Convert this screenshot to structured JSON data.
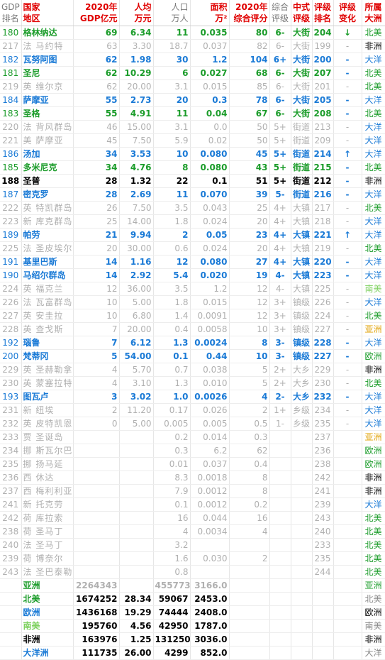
{
  "headers": {
    "gdp_rank": [
      "GDP",
      "排名"
    ],
    "country": [
      "国家",
      "地区"
    ],
    "gdp": [
      "2020年",
      "GDP亿元"
    ],
    "per_capita": [
      "人均",
      "万元"
    ],
    "population": [
      "人口",
      "万人"
    ],
    "area": [
      "面积",
      "万²"
    ],
    "score": [
      "2020年",
      "综合评分"
    ],
    "grade": [
      "综合",
      "评级"
    ],
    "cn_grade": [
      "中式",
      "评级"
    ],
    "grade_rank": [
      "评级",
      "排名"
    ],
    "change": [
      "评级",
      "变化"
    ],
    "continent": [
      "所属",
      "大洲"
    ]
  },
  "rows": [
    {
      "style": "green",
      "rank": "180",
      "name": "格林纳达",
      "gdp": "69",
      "pc": "6.34",
      "pop": "11",
      "area": "0.035",
      "score": "80",
      "grade": "6-",
      "tier": "大街",
      "grank": "204",
      "chg": "↓",
      "cont": "北美",
      "cc": "#1b9c2a"
    },
    {
      "style": "gray",
      "rank": "217",
      "name": "法 马约特",
      "gdp": "63",
      "pc": "3.30",
      "pop": "18.7",
      "area": "0.037",
      "score": "82",
      "grade": "6-",
      "tier": "大街",
      "grank": "199",
      "chg": "-",
      "cont": "非洲",
      "cc": "#000000"
    },
    {
      "style": "blue",
      "rank": "182",
      "name": "瓦努阿图",
      "gdp": "62",
      "pc": "1.98",
      "pop": "30",
      "area": "1.2",
      "score": "104",
      "grade": "6+",
      "tier": "大街",
      "grank": "200",
      "chg": "-",
      "cont": "大洋",
      "cc": "#1a7ad6"
    },
    {
      "style": "green",
      "rank": "181",
      "name": "圣尼",
      "gdp": "62",
      "pc": "10.29",
      "pop": "6",
      "area": "0.027",
      "score": "68",
      "grade": "6-",
      "tier": "大街",
      "grank": "207",
      "chg": "-",
      "cont": "北美",
      "cc": "#1b9c2a"
    },
    {
      "style": "gray",
      "rank": "219",
      "name": "英 维尔京",
      "gdp": "62",
      "pc": "20.00",
      "pop": "3.1",
      "area": "0.015",
      "score": "85",
      "grade": "6-",
      "tier": "大街",
      "grank": "201",
      "chg": "-",
      "cont": "北美",
      "cc": "#1b9c2a"
    },
    {
      "style": "blue",
      "rank": "184",
      "name": "萨摩亚",
      "gdp": "55",
      "pc": "2.73",
      "pop": "20",
      "area": "0.3",
      "score": "78",
      "grade": "6-",
      "tier": "大街",
      "grank": "205",
      "chg": "-",
      "cont": "大洋",
      "cc": "#1a7ad6"
    },
    {
      "style": "green",
      "rank": "183",
      "name": "圣格",
      "gdp": "55",
      "pc": "4.91",
      "pop": "11",
      "area": "0.04",
      "score": "67",
      "grade": "6-",
      "tier": "大街",
      "grank": "208",
      "chg": "-",
      "cont": "北美",
      "cc": "#1b9c2a"
    },
    {
      "style": "gray",
      "rank": "220",
      "name": "法 背风群岛",
      "gdp": "46",
      "pc": "15.00",
      "pop": "3.1",
      "area": "0.0",
      "score": "50",
      "grade": "5+",
      "tier": "街道",
      "grank": "213",
      "chg": "-",
      "cont": "大洋",
      "cc": "#1a7ad6"
    },
    {
      "style": "gray",
      "rank": "221",
      "name": "美 萨摩亚",
      "gdp": "45",
      "pc": "7.50",
      "pop": "5.9",
      "area": "0.02",
      "score": "50",
      "grade": "5+",
      "tier": "街道",
      "grank": "209",
      "chg": "-",
      "cont": "大洋",
      "cc": "#1a7ad6"
    },
    {
      "style": "blue",
      "rank": "186",
      "name": "汤加",
      "gdp": "34",
      "pc": "3.53",
      "pop": "10",
      "area": "0.080",
      "score": "45",
      "grade": "5+",
      "tier": "街道",
      "grank": "214",
      "chg": "↑",
      "cont": "大洋",
      "cc": "#1a7ad6"
    },
    {
      "style": "green",
      "rank": "185",
      "name": "多米尼克",
      "gdp": "34",
      "pc": "4.76",
      "pop": "8",
      "area": "0.080",
      "score": "43",
      "grade": "5+",
      "tier": "街道",
      "grank": "215",
      "chg": "-",
      "cont": "北美",
      "cc": "#1b9c2a"
    },
    {
      "style": "black",
      "rank": "188",
      "name": "圣普",
      "gdp": "28",
      "pc": "1.32",
      "pop": "22",
      "area": "0.1",
      "score": "51",
      "grade": "5+",
      "tier": "街道",
      "grank": "212",
      "chg": "-",
      "cont": "非洲",
      "cc": "#000000"
    },
    {
      "style": "blue",
      "rank": "187",
      "name": "密克罗",
      "gdp": "28",
      "pc": "2.69",
      "pop": "11",
      "area": "0.070",
      "score": "39",
      "grade": "5-",
      "tier": "街道",
      "grank": "216",
      "chg": "-",
      "cont": "大洋",
      "cc": "#1a7ad6"
    },
    {
      "style": "gray",
      "rank": "222",
      "name": "英 特凯群岛",
      "gdp": "26",
      "pc": "7.50",
      "pop": "3.5",
      "area": "0.043",
      "score": "25",
      "grade": "4+",
      "tier": "大镇",
      "grank": "217",
      "chg": "-",
      "cont": "北美",
      "cc": "#1b9c2a"
    },
    {
      "style": "gray",
      "rank": "223",
      "name": "新 库克群岛",
      "gdp": "25",
      "pc": "14.00",
      "pop": "1.8",
      "area": "0.024",
      "score": "20",
      "grade": "4+",
      "tier": "大镇",
      "grank": "218",
      "chg": "-",
      "cont": "大洋",
      "cc": "#1a7ad6"
    },
    {
      "style": "blue",
      "rank": "189",
      "name": "帕劳",
      "gdp": "21",
      "pc": "9.94",
      "pop": "2",
      "area": "0.05",
      "score": "23",
      "grade": "4+",
      "tier": "大镇",
      "grank": "221",
      "chg": "↑",
      "cont": "大洋",
      "cc": "#1a7ad6"
    },
    {
      "style": "gray",
      "rank": "225",
      "name": "法 圣皮埃尔",
      "gdp": "20",
      "pc": "30.00",
      "pop": "0.6",
      "area": "0.024",
      "score": "20",
      "grade": "4+",
      "tier": "大镇",
      "grank": "219",
      "chg": "-",
      "cont": "北美",
      "cc": "#1b9c2a"
    },
    {
      "style": "blue",
      "rank": "191",
      "name": "基里巴斯",
      "gdp": "14",
      "pc": "1.16",
      "pop": "12",
      "area": "0.080",
      "score": "27",
      "grade": "4+",
      "tier": "大镇",
      "grank": "220",
      "chg": "-",
      "cont": "大洋",
      "cc": "#1a7ad6"
    },
    {
      "style": "blue",
      "rank": "190",
      "name": "马绍尔群岛",
      "gdp": "14",
      "pc": "2.92",
      "pop": "5.4",
      "area": "0.020",
      "score": "19",
      "grade": "4-",
      "tier": "大镇",
      "grank": "223",
      "chg": "-",
      "cont": "大洋",
      "cc": "#1a7ad6"
    },
    {
      "style": "gray",
      "rank": "224",
      "name": "英 福克兰",
      "gdp": "12",
      "pc": "36.00",
      "pop": "3.5",
      "area": "1.2",
      "score": "12",
      "grade": "4-",
      "tier": "大镇",
      "grank": "225",
      "chg": "-",
      "cont": "南美",
      "cc": "#7fd160"
    },
    {
      "style": "gray",
      "rank": "226",
      "name": "法 瓦富群岛",
      "gdp": "10",
      "pc": "5.00",
      "pop": "1.8",
      "area": "0.015",
      "score": "12",
      "grade": "3+",
      "tier": "镇级",
      "grank": "226",
      "chg": "-",
      "cont": "大洋",
      "cc": "#1a7ad6"
    },
    {
      "style": "gray",
      "rank": "227",
      "name": "英 安圭拉",
      "gdp": "10",
      "pc": "6.80",
      "pop": "1.4",
      "area": "0.0091",
      "score": "12",
      "grade": "3+",
      "tier": "镇级",
      "grank": "224",
      "chg": "-",
      "cont": "北美",
      "cc": "#1b9c2a"
    },
    {
      "style": "gray",
      "rank": "228",
      "name": "英 查戈斯",
      "gdp": "7",
      "pc": "20.00",
      "pop": "0.4",
      "area": "0.0058",
      "score": "10",
      "grade": "3+",
      "tier": "镇级",
      "grank": "227",
      "chg": "-",
      "cont": "亚洲",
      "cc": "#e0a000"
    },
    {
      "style": "blue",
      "rank": "192",
      "name": "瑙鲁",
      "gdp": "7",
      "pc": "6.12",
      "pop": "1.3",
      "area": "0.0024",
      "score": "8",
      "grade": "3-",
      "tier": "镇级",
      "grank": "228",
      "chg": "-",
      "cont": "大洋",
      "cc": "#1a7ad6"
    },
    {
      "style": "blue",
      "rank": "200",
      "name": "梵蒂冈",
      "gdp": "5",
      "pc": "54.00",
      "pop": "0.1",
      "area": "0.44",
      "score": "10",
      "grade": "3-",
      "tier": "镇级",
      "grank": "227",
      "chg": "-",
      "cont": "欧洲",
      "cc": "#1b9c2a"
    },
    {
      "style": "gray",
      "rank": "229",
      "name": "英 圣赫勒拿",
      "gdp": "4",
      "pc": "5.70",
      "pop": "0.7",
      "area": "0.038",
      "score": "5",
      "grade": "2+",
      "tier": "大乡",
      "grank": "229",
      "chg": "-",
      "cont": "非洲",
      "cc": "#000000"
    },
    {
      "style": "gray",
      "rank": "230",
      "name": "英 蒙塞拉特",
      "gdp": "4",
      "pc": "3.10",
      "pop": "1.3",
      "area": "0.010",
      "score": "5",
      "grade": "2+",
      "tier": "大乡",
      "grank": "230",
      "chg": "-",
      "cont": "北美",
      "cc": "#1b9c2a"
    },
    {
      "style": "blue",
      "rank": "193",
      "name": "图瓦卢",
      "gdp": "3",
      "pc": "3.02",
      "pop": "1.0",
      "area": "0.0026",
      "score": "4",
      "grade": "2-",
      "tier": "大乡",
      "grank": "232",
      "chg": "-",
      "cont": "大洋",
      "cc": "#1a7ad6"
    },
    {
      "style": "gray",
      "rank": "231",
      "name": "新 纽埃",
      "gdp": "2",
      "pc": "11.20",
      "pop": "0.17",
      "area": "0.026",
      "score": "2",
      "grade": "1+",
      "tier": "乡级",
      "grank": "234",
      "chg": "-",
      "cont": "大洋",
      "cc": "#1a7ad6"
    },
    {
      "style": "gray",
      "rank": "232",
      "name": "英 皮特凯恩",
      "gdp": "0",
      "pc": "5.00",
      "pop": "0.005",
      "area": "0.005",
      "score": "0.5",
      "grade": "1-",
      "tier": "乡级",
      "grank": "235",
      "chg": "-",
      "cont": "大洋",
      "cc": "#1a7ad6"
    },
    {
      "style": "gray",
      "rank": "233",
      "name": "贾 圣诞岛",
      "gdp": "",
      "pc": "",
      "pop": "0.2",
      "area": "0.014",
      "score": "0.3",
      "grade": "",
      "tier": "",
      "grank": "237",
      "chg": "",
      "cont": "亚洲",
      "cc": "#e0a000"
    },
    {
      "style": "gray",
      "rank": "234",
      "name": "挪 斯瓦尔巴",
      "gdp": "",
      "pc": "",
      "pop": "0.3",
      "area": "6.2",
      "score": "62",
      "grade": "",
      "tier": "",
      "grank": "236",
      "chg": "",
      "cont": "欧洲",
      "cc": "#1b9c2a"
    },
    {
      "style": "gray",
      "rank": "235",
      "name": "挪 扬马延",
      "gdp": "",
      "pc": "",
      "pop": "0.01",
      "area": "0.037",
      "score": "0.4",
      "grade": "",
      "tier": "",
      "grank": "238",
      "chg": "",
      "cont": "欧洲",
      "cc": "#1b9c2a"
    },
    {
      "style": "gray",
      "rank": "236",
      "name": "西 休达",
      "gdp": "",
      "pc": "",
      "pop": "8.3",
      "area": "0.0018",
      "score": "8",
      "grade": "",
      "tier": "",
      "grank": "242",
      "chg": "",
      "cont": "非洲",
      "cc": "#000000"
    },
    {
      "style": "gray",
      "rank": "237",
      "name": "西 梅利利亚",
      "gdp": "",
      "pc": "",
      "pop": "7.9",
      "area": "0.0012",
      "score": "8",
      "grade": "",
      "tier": "",
      "grank": "241",
      "chg": "",
      "cont": "非洲",
      "cc": "#000000"
    },
    {
      "style": "gray",
      "rank": "241",
      "name": "新 托克劳",
      "gdp": "",
      "pc": "",
      "pop": "0.1",
      "area": "0.0012",
      "score": "0.2",
      "grade": "",
      "tier": "",
      "grank": "239",
      "chg": "",
      "cont": "大洋",
      "cc": "#1a7ad6"
    },
    {
      "style": "gray",
      "rank": "242",
      "name": "荷 库拉索",
      "gdp": "",
      "pc": "",
      "pop": "16",
      "area": "0.044",
      "score": "16",
      "grade": "",
      "tier": "",
      "grank": "243",
      "chg": "",
      "cont": "北美",
      "cc": "#1b9c2a"
    },
    {
      "style": "gray",
      "rank": "238",
      "name": "荷 圣马丁",
      "gdp": "",
      "pc": "",
      "pop": "4",
      "area": "0.0034",
      "score": "4",
      "grade": "",
      "tier": "",
      "grank": "240",
      "chg": "",
      "cont": "北美",
      "cc": "#1b9c2a"
    },
    {
      "style": "gray",
      "rank": "240",
      "name": "法 圣马丁",
      "gdp": "",
      "pc": "",
      "pop": "3.2",
      "area": "",
      "score": "",
      "grade": "",
      "tier": "",
      "grank": "233",
      "chg": "",
      "cont": "北美",
      "cc": "#1b9c2a"
    },
    {
      "style": "gray",
      "rank": "239",
      "name": "荷 博奈尔",
      "gdp": "",
      "pc": "",
      "pop": "1.6",
      "area": "0.030",
      "score": "2",
      "grade": "",
      "tier": "",
      "grank": "235",
      "chg": "",
      "cont": "北美",
      "cc": "#1b9c2a"
    },
    {
      "style": "gray",
      "rank": "243",
      "name": "法 圣巴泰勒米",
      "gdp": "",
      "pc": "",
      "pop": "0.8",
      "area": "",
      "score": "",
      "grade": "",
      "tier": "",
      "grank": "244",
      "chg": "",
      "cont": "北美",
      "cc": "#1b9c2a"
    }
  ],
  "summary": [
    {
      "name": "亚洲",
      "gdp": "2264343",
      "pc": "",
      "pop": "455773",
      "area": "3166.0",
      "cont": "亚洲",
      "gray": true,
      "nc": "#1b9c2a",
      "cc": "#1b9c2a"
    },
    {
      "name": "北美",
      "gdp": "1674252",
      "pc": "28.34",
      "pop": "59067",
      "area": "2453.0",
      "cont": "北美",
      "gray": false,
      "nc": "#1b9c2a",
      "cc": "#888888"
    },
    {
      "name": "欧洲",
      "gdp": "1436168",
      "pc": "19.29",
      "pop": "74444",
      "area": "2408.0",
      "cont": "欧洲",
      "gray": false,
      "nc": "#1a7ad6",
      "cc": "#000000"
    },
    {
      "name": "南美",
      "gdp": "195760",
      "pc": "4.56",
      "pop": "42950",
      "area": "1787.0",
      "cont": "南美",
      "gray": false,
      "nc": "#7fd160",
      "cc": "#888888"
    },
    {
      "name": "非洲",
      "gdp": "163976",
      "pc": "1.25",
      "pop": "131250",
      "area": "3036.0",
      "cont": "非洲",
      "gray": false,
      "nc": "#000000",
      "cc": "#000000"
    },
    {
      "name": "大洋洲",
      "gdp": "111735",
      "pc": "26.00",
      "pop": "4299",
      "area": "852.0",
      "cont": "大洋",
      "gray": false,
      "nc": "#1a7ad6",
      "cc": "#888888"
    }
  ],
  "colors": {
    "blue": "#1a7ad6",
    "green": "#1b9c2a",
    "red": "#e00000",
    "gray": "#b0b0b0"
  }
}
